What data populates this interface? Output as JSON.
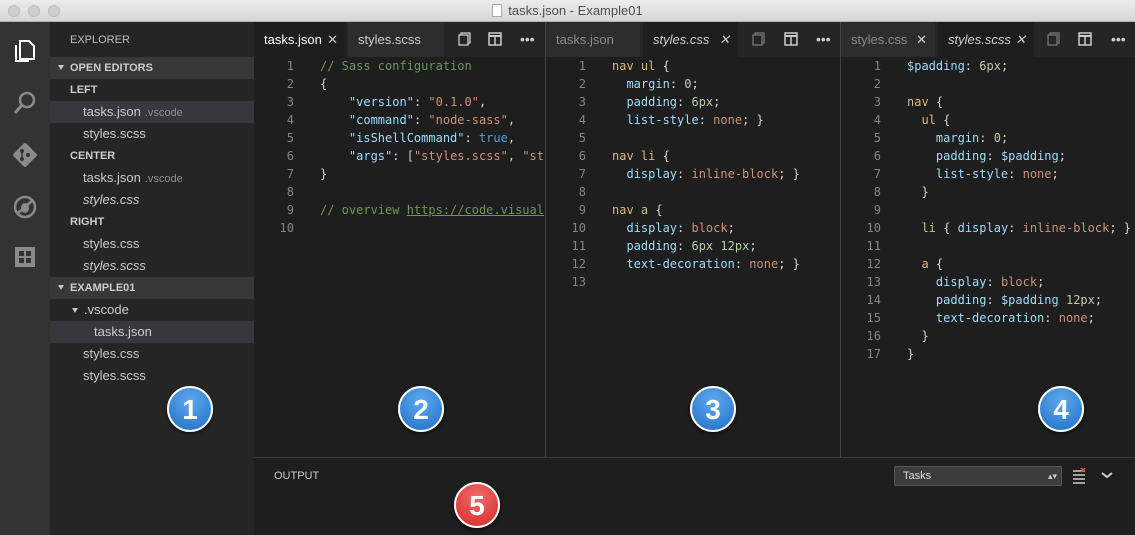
{
  "window": {
    "title": "tasks.json - Example01"
  },
  "sidebar": {
    "title": "EXPLORER",
    "open_editors": "OPEN EDITORS",
    "groups": [
      {
        "label": "LEFT",
        "items": [
          {
            "name": "tasks.json",
            "desc": ".vscode"
          },
          {
            "name": "styles.scss"
          }
        ]
      },
      {
        "label": "CENTER",
        "items": [
          {
            "name": "tasks.json",
            "desc": ".vscode"
          },
          {
            "name": "styles.css"
          }
        ]
      },
      {
        "label": "RIGHT",
        "items": [
          {
            "name": "styles.css"
          },
          {
            "name": "styles.scss"
          }
        ]
      }
    ],
    "project": "EXAMPLE01",
    "folder": ".vscode",
    "folder_file": "tasks.json",
    "files": [
      "styles.css",
      "styles.scss"
    ]
  },
  "tabs": {
    "left": [
      {
        "label": "tasks.json"
      },
      {
        "label": "styles.scss"
      }
    ],
    "center": [
      {
        "label": "tasks.json"
      },
      {
        "label": "styles.css"
      }
    ],
    "right": [
      {
        "label": "styles.css"
      },
      {
        "label": "styles.scss"
      }
    ]
  },
  "editors": {
    "left": {
      "line_numbers": [
        "1",
        "2",
        "3",
        "4",
        "5",
        "6",
        "7",
        "8",
        "9",
        "10"
      ],
      "lines": [
        "// Sass configuration",
        "{",
        "    \"version\": \"0.1.0\",",
        "    \"command\": \"node-sass\",",
        "    \"isShellCommand\": true,",
        "    \"args\": [\"styles.scss\", \"st",
        "}",
        "",
        "// overview https://code.visual",
        ""
      ]
    },
    "center": {
      "line_numbers": [
        "1",
        "2",
        "3",
        "4",
        "5",
        "6",
        "7",
        "8",
        "9",
        "10",
        "11",
        "12",
        "13"
      ],
      "lines": [
        "nav ul {",
        "  margin: 0;",
        "  padding: 6px;",
        "  list-style: none; }",
        "",
        "nav li {",
        "  display: inline-block; }",
        "",
        "nav a {",
        "  display: block;",
        "  padding: 6px 12px;",
        "  text-decoration: none; }",
        ""
      ]
    },
    "right": {
      "line_numbers": [
        "1",
        "2",
        "3",
        "4",
        "5",
        "6",
        "7",
        "8",
        "9",
        "10",
        "11",
        "12",
        "13",
        "14",
        "15",
        "16",
        "17"
      ],
      "lines": [
        "$padding: 6px;",
        "",
        "nav {",
        "  ul {",
        "    margin: 0;",
        "    padding: $padding;",
        "    list-style: none;",
        "  }",
        "",
        "  li { display: inline-block; }",
        "",
        "  a {",
        "    display: block;",
        "    padding: $padding 12px;",
        "    text-decoration: none;",
        "  }",
        "}"
      ]
    }
  },
  "badges": [
    "1",
    "2",
    "3",
    "4",
    "5"
  ],
  "panel": {
    "title": "OUTPUT",
    "select_value": "Tasks"
  },
  "colors": {
    "accent_badge": "#2a7fd4",
    "alert_badge": "#e03333",
    "activity_bar": "#333333",
    "sidebar": "#252526",
    "editor": "#1e1e1e"
  }
}
